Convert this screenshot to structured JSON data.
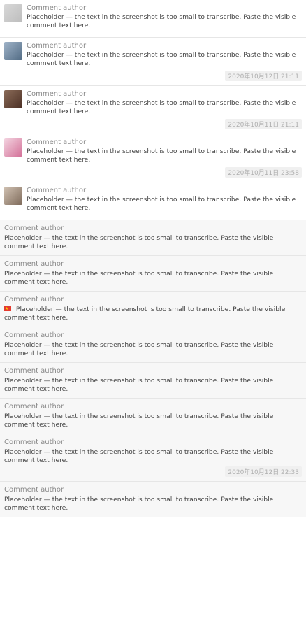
{
  "comments": [
    {
      "name": "Comment author",
      "text": [
        "Placeholder — the text in the screenshot is too small to transcribe. Paste the visible comment text here."
      ],
      "time": "",
      "avatar": "a1"
    },
    {
      "name": "Comment author",
      "text": [
        "Placeholder — the text in the screenshot is too small to transcribe. Paste the visible comment text here."
      ],
      "time": "2020年10月12日 21:11",
      "avatar": "a2"
    },
    {
      "name": "Comment author",
      "text": [
        "Placeholder — the text in the screenshot is too small to transcribe. Paste the visible comment text here."
      ],
      "time": "2020年10月11日 21:11",
      "avatar": "a3"
    },
    {
      "name": "Comment author",
      "text": [
        "Placeholder — the text in the screenshot is too small to transcribe. Paste the visible comment text here."
      ],
      "time": "2020年10月11日 23:58",
      "avatar": "a4"
    },
    {
      "name": "Comment author",
      "text": [
        "Placeholder — the text in the screenshot is too small to transcribe. Paste the visible comment text here."
      ],
      "time": "",
      "avatar": "a5"
    }
  ],
  "simple_comments": [
    {
      "name": "Comment author",
      "text": "Placeholder — the text in the screenshot is too small to transcribe. Paste the visible comment text here.",
      "time": ""
    },
    {
      "name": "Comment author",
      "text": "Placeholder — the text in the screenshot is too small to transcribe. Paste the visible comment text here.",
      "time": ""
    },
    {
      "name": "Comment author",
      "text": "Placeholder — the text in the screenshot is too small to transcribe. Paste the visible comment text here.",
      "time": "",
      "flag": true
    },
    {
      "name": "Comment author",
      "text": "Placeholder — the text in the screenshot is too small to transcribe. Paste the visible comment text here.",
      "time": ""
    },
    {
      "name": "Comment author",
      "text": "Placeholder — the text in the screenshot is too small to transcribe. Paste the visible comment text here.",
      "time": ""
    },
    {
      "name": "Comment author",
      "text": "Placeholder — the text in the screenshot is too small to transcribe. Paste the visible comment text here.",
      "time": ""
    },
    {
      "name": "Comment author",
      "text": "Placeholder — the text in the screenshot is too small to transcribe. Paste the visible comment text here.",
      "time": "2020年10月12日 22:33"
    },
    {
      "name": "Comment author",
      "text": "Placeholder — the text in the screenshot is too small to transcribe. Paste the visible comment text here.",
      "time": ""
    }
  ]
}
